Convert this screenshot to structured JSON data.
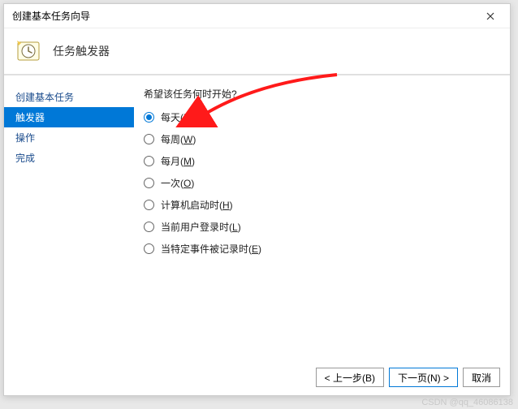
{
  "titlebar": {
    "title": "创建基本任务向导"
  },
  "header": {
    "title": "任务触发器"
  },
  "sidebar": {
    "items": [
      {
        "label": "创建基本任务",
        "active": false
      },
      {
        "label": "触发器",
        "active": true
      },
      {
        "label": "操作",
        "active": false
      },
      {
        "label": "完成",
        "active": false
      }
    ]
  },
  "main": {
    "prompt": "希望该任务何时开始?",
    "options": [
      {
        "text": "每天",
        "mnemonic": "D",
        "selected": true
      },
      {
        "text": "每周",
        "mnemonic": "W",
        "selected": false
      },
      {
        "text": "每月",
        "mnemonic": "M",
        "selected": false
      },
      {
        "text": "一次",
        "mnemonic": "O",
        "selected": false
      },
      {
        "text": "计算机启动时",
        "mnemonic": "H",
        "selected": false
      },
      {
        "text": "当前用户登录时",
        "mnemonic": "L",
        "selected": false
      },
      {
        "text": "当特定事件被记录时",
        "mnemonic": "E",
        "selected": false
      }
    ]
  },
  "footer": {
    "back": "< 上一步(B)",
    "next": "下一页(N) >",
    "cancel": "取消"
  },
  "watermark": "CSDN @qq_46086138"
}
